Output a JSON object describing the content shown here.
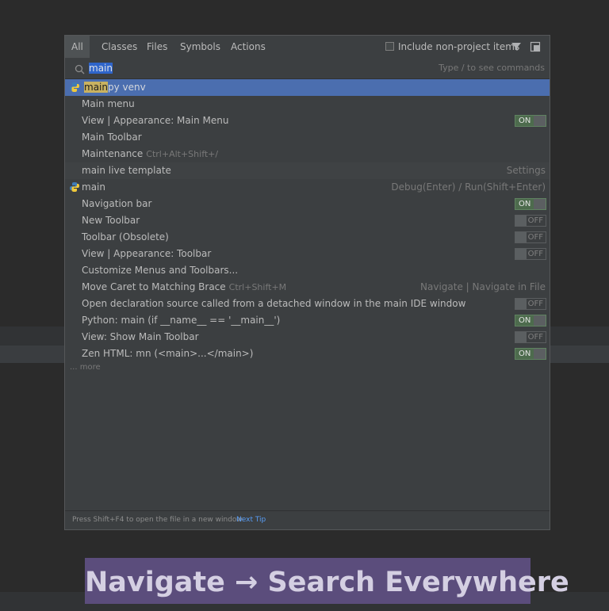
{
  "tabs": [
    {
      "label": "All",
      "active": true
    },
    {
      "label": "Classes",
      "active": false
    },
    {
      "label": "Files",
      "active": false
    },
    {
      "label": "Symbols",
      "active": false
    },
    {
      "label": "Actions",
      "active": false
    }
  ],
  "include_label": "Include non-project items",
  "include_checked": false,
  "icons": {
    "filter": "filter-icon",
    "pin": "pin-window-icon",
    "search": "search-icon",
    "python": "python-icon"
  },
  "search": {
    "query": "main",
    "hint": "Type / to see commands"
  },
  "results": [
    {
      "match": "main",
      "text": "py venv",
      "icon": "python-icon",
      "selected": true
    },
    {
      "text": "Main menu"
    },
    {
      "text": "View | Appearance: Main Menu",
      "toggle": "ON"
    },
    {
      "text": "Main Toolbar"
    },
    {
      "text": "Maintenance",
      "shortcut": "Ctrl+Alt+Shift+/"
    },
    {
      "text": "main live template",
      "right": "Settings",
      "alt": true
    },
    {
      "text": "main",
      "icon": "python-icon",
      "right": "Debug(Enter) / Run(Shift+Enter)"
    },
    {
      "text": "Navigation bar",
      "toggle": "ON"
    },
    {
      "text": "New Toolbar",
      "toggle": "OFF"
    },
    {
      "text": "Toolbar (Obsolete)",
      "toggle": "OFF"
    },
    {
      "text": "View | Appearance: Toolbar",
      "toggle": "OFF"
    },
    {
      "text": "Customize Menus and Toolbars..."
    },
    {
      "text": "Move Caret to Matching Brace",
      "shortcut": "Ctrl+Shift+M",
      "right": "Navigate | Navigate in File"
    },
    {
      "text": "Open declaration source called from a detached window in the main IDE window",
      "toggle": "OFF"
    },
    {
      "text": "Python: main (if __name__ == '__main__')",
      "toggle": "ON"
    },
    {
      "text": "View: Show Main Toolbar",
      "toggle": "OFF"
    },
    {
      "text": "Zen HTML: mn (<main>...</main>)",
      "toggle": "ON"
    }
  ],
  "more_label": "... more",
  "footer": {
    "tip": "Press Shift+F4 to open the file in a new window",
    "next_tip": "Next Tip"
  },
  "banner": "Navigate → Search Everywhere",
  "colors": {
    "selection": "#4b6eaf",
    "highlight": "#c9b260",
    "banner": "#5b4d7c",
    "toggle_on": "#4d6b4d",
    "link": "#589df6"
  }
}
